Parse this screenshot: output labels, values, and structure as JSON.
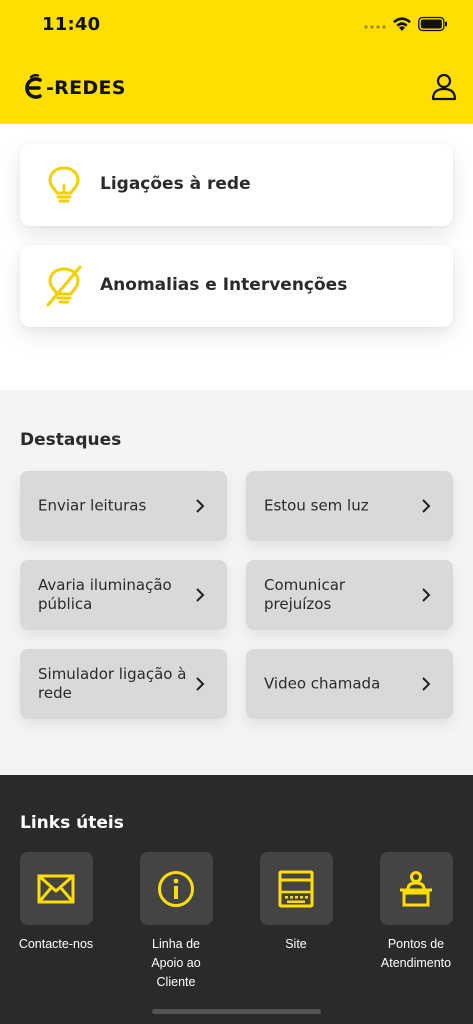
{
  "status_bar": {
    "time": "11:40"
  },
  "header": {
    "logo_text": "-REDES",
    "logo_icon": "e-redes-logo-icon",
    "profile_icon": "user-icon"
  },
  "cards": [
    {
      "label": "Ligações à rede",
      "icon": "lightbulb-icon"
    },
    {
      "label": "Anomalias e Intervenções",
      "icon": "lightbulb-off-icon"
    }
  ],
  "destaques": {
    "title": "Destaques",
    "items": [
      {
        "label": "Enviar leituras"
      },
      {
        "label": "Estou sem luz"
      },
      {
        "label": "Avaria iluminação pública"
      },
      {
        "label": "Comunicar prejuízos"
      },
      {
        "label": "Simulador ligação à rede"
      },
      {
        "label": "Video chamada"
      }
    ]
  },
  "links": {
    "title": "Links úteis",
    "items": [
      {
        "label": "Contacte-nos",
        "icon": "envelope-icon"
      },
      {
        "label": "Linha de Apoio ao Cliente",
        "icon": "info-icon"
      },
      {
        "label": "Site",
        "icon": "website-icon"
      },
      {
        "label": "Pontos de Atendimento",
        "icon": "service-desk-icon"
      }
    ]
  },
  "colors": {
    "brand_yellow": "#FFDE00",
    "dark_bg": "#2A2A2A",
    "tile_bg": "#D9D9D9"
  }
}
